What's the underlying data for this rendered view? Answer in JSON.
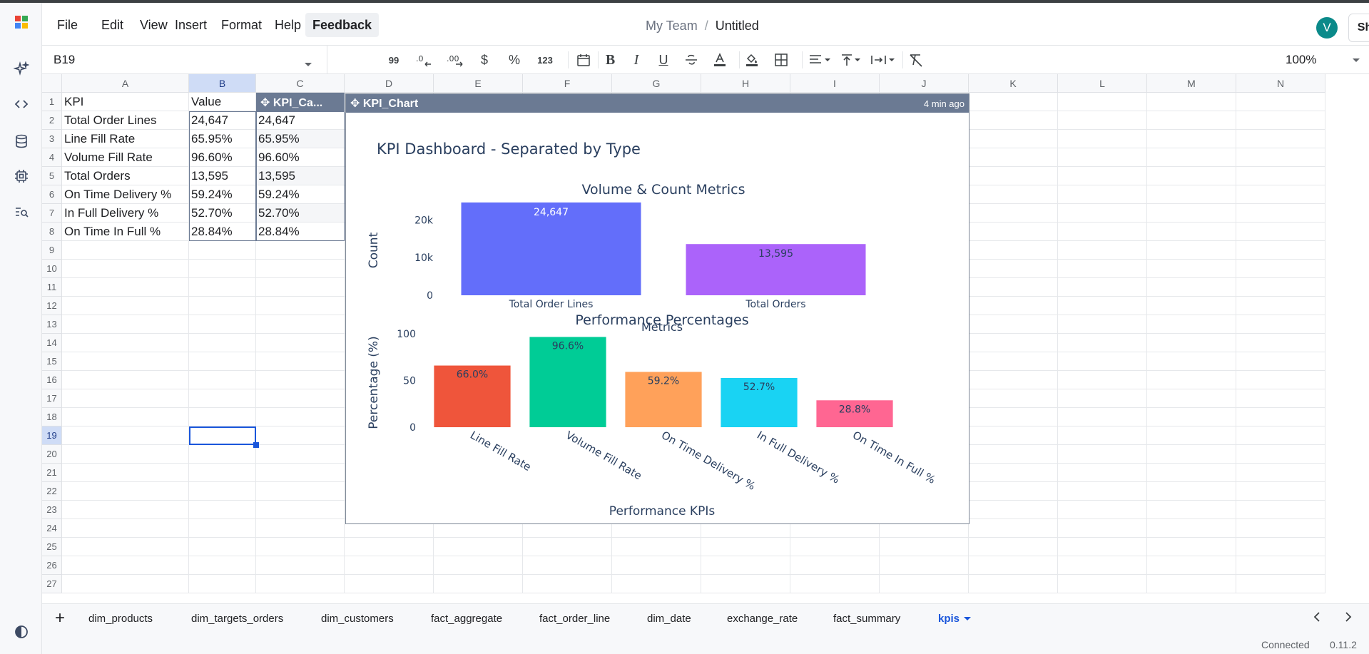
{
  "menu": {
    "items": [
      "File",
      "Edit",
      "View",
      "Insert",
      "Format",
      "Help",
      "Feedback"
    ],
    "team": "My Team",
    "separator": "/",
    "doc_title": "Untitled",
    "avatar_letter": "V",
    "share_label": "Share"
  },
  "toolbar": {
    "cell_ref": "B19",
    "zoom": "100%",
    "format_99": "99",
    "format_123": "123",
    "dollar": "$",
    "percent": "%"
  },
  "grid": {
    "columns": [
      "A",
      "B",
      "C",
      "D",
      "E",
      "F",
      "G",
      "H",
      "I",
      "J",
      "K",
      "L",
      "M",
      "N"
    ],
    "rows": [
      "1",
      "2",
      "3",
      "4",
      "5",
      "6",
      "7",
      "8",
      "9",
      "10",
      "11",
      "12",
      "13",
      "14",
      "15",
      "16",
      "17",
      "18",
      "19",
      "20",
      "21",
      "22",
      "23",
      "24",
      "25",
      "26",
      "27"
    ],
    "cells": {
      "a": [
        "KPI",
        "Total Order Lines",
        "Line Fill Rate",
        "Volume Fill Rate",
        "Total Orders",
        "On Time Delivery %",
        "In Full Delivery %",
        "On Time In Full %"
      ],
      "b": [
        "Value",
        "24,647",
        "65.95%",
        "96.60%",
        "13,595",
        "59.24%",
        "52.70%",
        "28.84%"
      ],
      "c": [
        "",
        "24,647",
        "65.95%",
        "96.60%",
        "13,595",
        "59.24%",
        "52.70%",
        "28.84%"
      ]
    },
    "kpi_ca_header": "✥ KPI_Ca...",
    "chart_header": "✥ KPI_Chart",
    "chart_age": "4 min ago"
  },
  "chart_data": [
    {
      "type": "bar",
      "title": "Volume & Count Metrics",
      "categories": [
        "Total Order Lines",
        "Total Orders"
      ],
      "values": [
        24647,
        13595
      ],
      "labels": [
        "24,647",
        "13,595"
      ],
      "colors": [
        "#636efa",
        "#ab63fa"
      ],
      "xlabel": "Metrics",
      "ylabel": "Count",
      "yticks": [
        "0",
        "10k",
        "20k"
      ],
      "ylim": [
        0,
        25000
      ]
    },
    {
      "type": "bar",
      "title": "Performance Percentages",
      "categories": [
        "Line Fill Rate",
        "Volume Fill Rate",
        "On Time Delivery %",
        "In Full Delivery %",
        "On Time In Full %"
      ],
      "values": [
        66.0,
        96.6,
        59.2,
        52.7,
        28.8
      ],
      "labels": [
        "66.0%",
        "96.6%",
        "59.2%",
        "52.7%",
        "28.8%"
      ],
      "colors": [
        "#ef553b",
        "#00cc96",
        "#ffa15a",
        "#19d3f3",
        "#ff6692"
      ],
      "xlabel": "Performance KPIs",
      "ylabel": "Percentage (%)",
      "yticks": [
        "0",
        "50",
        "100"
      ],
      "ylim": [
        0,
        100
      ]
    }
  ],
  "dashboard_title": "KPI Dashboard - Separated by Type",
  "sheets": [
    "dim_products",
    "dim_targets_orders",
    "dim_customers",
    "fact_aggregate",
    "fact_order_line",
    "dim_date",
    "exchange_rate",
    "fact_summary",
    "kpis"
  ],
  "status": {
    "connection": "Connected",
    "version": "0.11.2"
  }
}
